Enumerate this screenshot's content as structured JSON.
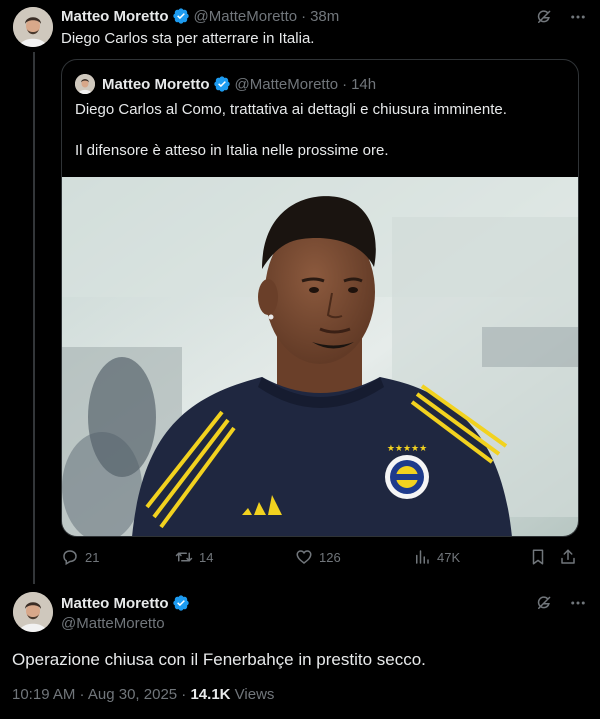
{
  "tweet1": {
    "author_name": "Matteo Moretto",
    "handle": "@MatteMoretto",
    "separator": "·",
    "time": "38m",
    "text": "Diego Carlos sta per atterrare in Italia.",
    "quoted": {
      "author_name": "Matteo Moretto",
      "handle": "@MatteMoretto",
      "separator": "·",
      "time": "14h",
      "text_line1": "Diego Carlos al Como, trattativa ai dettagli e chiusura imminente.",
      "text_line2": "Il difensore è atteso in Italia nelle prossime ore."
    },
    "actions": {
      "replies": "21",
      "reposts": "14",
      "likes": "126",
      "views": "47K"
    }
  },
  "tweet2": {
    "author_name": "Matteo Moretto",
    "handle": "@MatteMoretto",
    "text": "Operazione chiusa con il Fenerbahçe in prestito secco.",
    "timestamp": "10:19 AM · Aug 30, 2025 · ",
    "views_count": "14.1K",
    "views_label": " Views"
  },
  "colors": {
    "background": "#000000",
    "text": "#e7e9ea",
    "muted": "#71767b",
    "verified": "#1d9bf0",
    "border": "#2f3336"
  }
}
